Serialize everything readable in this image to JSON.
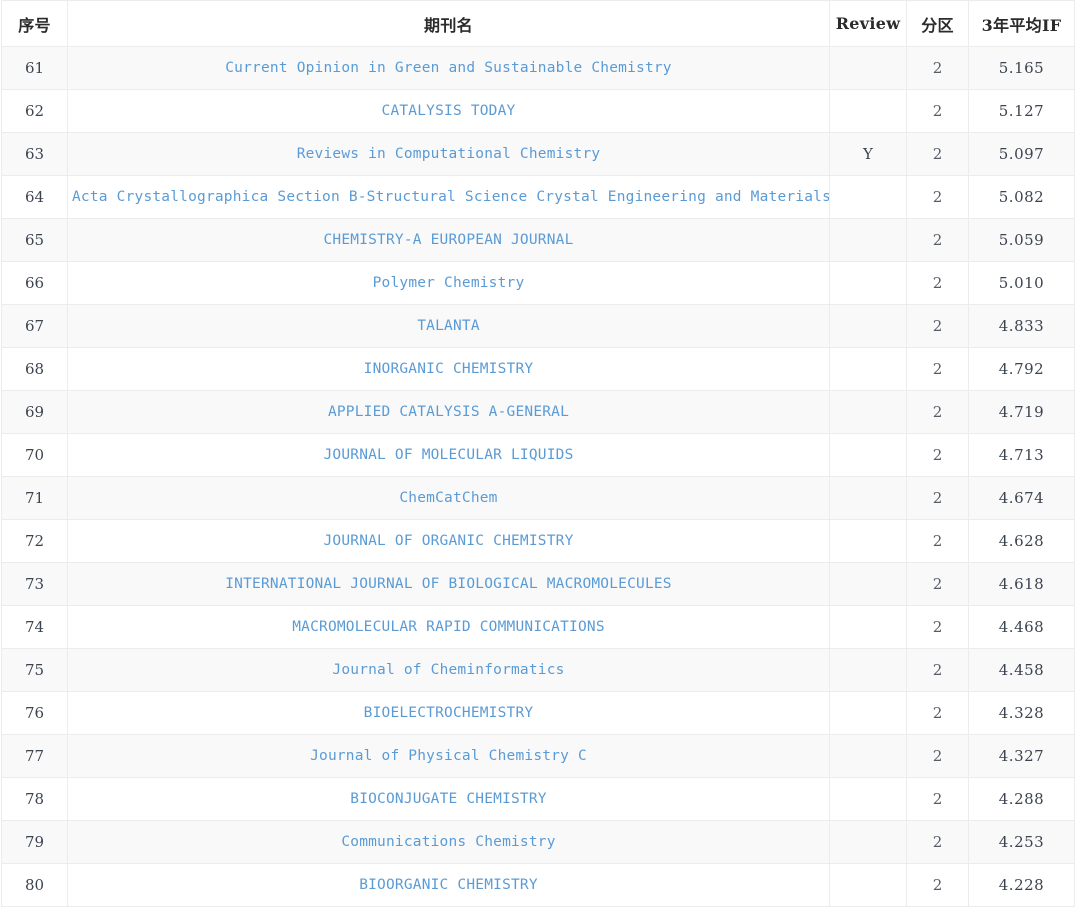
{
  "table": {
    "headers": {
      "index": "序号",
      "name": "期刊名",
      "review": "Review",
      "zone": "分区",
      "if3y": "3年平均IF"
    },
    "link_color": "#5b9bd5",
    "rows": [
      {
        "index": "61",
        "name": "Current Opinion in Green and Sustainable Chemistry",
        "review": "",
        "zone": "2",
        "if3y": "5.165"
      },
      {
        "index": "62",
        "name": "CATALYSIS TODAY",
        "review": "",
        "zone": "2",
        "if3y": "5.127"
      },
      {
        "index": "63",
        "name": "Reviews in Computational Chemistry",
        "review": "Y",
        "zone": "2",
        "if3y": "5.097"
      },
      {
        "index": "64",
        "name": "Acta Crystallographica Section B-Structural Science Crystal Engineering and Materials",
        "review": "",
        "zone": "2",
        "if3y": "5.082"
      },
      {
        "index": "65",
        "name": "CHEMISTRY-A EUROPEAN JOURNAL",
        "review": "",
        "zone": "2",
        "if3y": "5.059"
      },
      {
        "index": "66",
        "name": "Polymer Chemistry",
        "review": "",
        "zone": "2",
        "if3y": "5.010"
      },
      {
        "index": "67",
        "name": "TALANTA",
        "review": "",
        "zone": "2",
        "if3y": "4.833"
      },
      {
        "index": "68",
        "name": "INORGANIC CHEMISTRY",
        "review": "",
        "zone": "2",
        "if3y": "4.792"
      },
      {
        "index": "69",
        "name": "APPLIED CATALYSIS A-GENERAL",
        "review": "",
        "zone": "2",
        "if3y": "4.719"
      },
      {
        "index": "70",
        "name": "JOURNAL OF MOLECULAR LIQUIDS",
        "review": "",
        "zone": "2",
        "if3y": "4.713"
      },
      {
        "index": "71",
        "name": "ChemCatChem",
        "review": "",
        "zone": "2",
        "if3y": "4.674"
      },
      {
        "index": "72",
        "name": "JOURNAL OF ORGANIC CHEMISTRY",
        "review": "",
        "zone": "2",
        "if3y": "4.628"
      },
      {
        "index": "73",
        "name": "INTERNATIONAL JOURNAL OF BIOLOGICAL MACROMOLECULES",
        "review": "",
        "zone": "2",
        "if3y": "4.618"
      },
      {
        "index": "74",
        "name": "MACROMOLECULAR RAPID COMMUNICATIONS",
        "review": "",
        "zone": "2",
        "if3y": "4.468"
      },
      {
        "index": "75",
        "name": "Journal of Cheminformatics",
        "review": "",
        "zone": "2",
        "if3y": "4.458"
      },
      {
        "index": "76",
        "name": "BIOELECTROCHEMISTRY",
        "review": "",
        "zone": "2",
        "if3y": "4.328"
      },
      {
        "index": "77",
        "name": "Journal of Physical Chemistry C",
        "review": "",
        "zone": "2",
        "if3y": "4.327"
      },
      {
        "index": "78",
        "name": "BIOCONJUGATE CHEMISTRY",
        "review": "",
        "zone": "2",
        "if3y": "4.288"
      },
      {
        "index": "79",
        "name": "Communications Chemistry",
        "review": "",
        "zone": "2",
        "if3y": "4.253"
      },
      {
        "index": "80",
        "name": "BIOORGANIC CHEMISTRY",
        "review": "",
        "zone": "2",
        "if3y": "4.228"
      }
    ]
  }
}
